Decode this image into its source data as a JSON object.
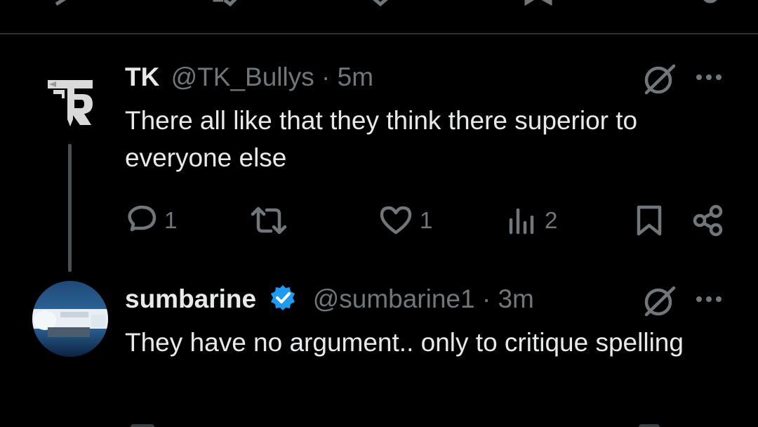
{
  "colors": {
    "background": "#000000",
    "text_primary": "#e7e9ea",
    "text_secondary": "#71767b",
    "verified_badge": "#1d9bf0",
    "divider": "#2f3336"
  },
  "replies": [
    {
      "display_name": "TK",
      "handle": "@TK_Bullys",
      "separator": "·",
      "time": "5m",
      "verified": false,
      "avatar_icon": "tk-logo-avatar",
      "text": "There all like that they think there superior to everyone else",
      "actions": {
        "reply_count": "1",
        "repost_count": "",
        "like_count": "1",
        "views_count": "2"
      }
    },
    {
      "display_name": "sumbarine",
      "handle": "@sumbarine1",
      "separator": "·",
      "time": "3m",
      "verified": true,
      "avatar_icon": "submarine-photo-avatar",
      "text": "They have no argument.. only to critique spelling"
    }
  ],
  "icons": {
    "reply": "reply-icon",
    "repost": "repost-icon",
    "like": "like-icon",
    "views": "views-icon",
    "bookmark": "bookmark-icon",
    "share": "share-icon",
    "grok": "grok-icon",
    "more": "more-icon",
    "verified": "verified-badge-icon"
  }
}
